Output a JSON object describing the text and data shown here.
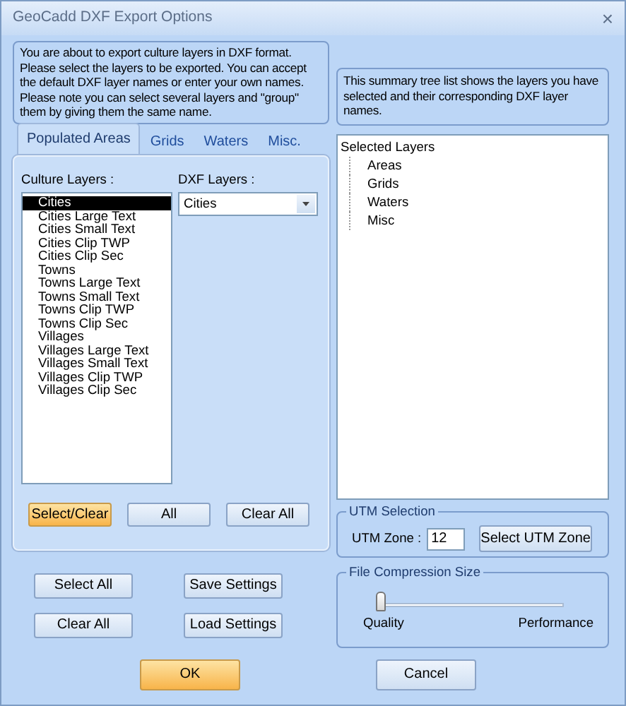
{
  "window": {
    "title": "GeoCadd DXF Export Options",
    "close": "×"
  },
  "intro": "You are about to export culture layers in DXF format. Please select the layers to be exported. You can accept the default DXF layer names or enter your own names. Please note you can select several layers and \"group\" them by giving them the same name.",
  "tabs": [
    {
      "label": "Populated Areas",
      "selected": true
    },
    {
      "label": "Grids",
      "selected": false
    },
    {
      "label": "Waters",
      "selected": false
    },
    {
      "label": "Misc.",
      "selected": false
    }
  ],
  "culture_label": "Culture Layers :",
  "culture_layers": [
    {
      "label": "Cities",
      "selected": true
    },
    {
      "label": "Cities Large Text",
      "selected": false
    },
    {
      "label": "Cities Small Text",
      "selected": false
    },
    {
      "label": "Cities Clip TWP",
      "selected": false
    },
    {
      "label": "Cities Clip Sec",
      "selected": false
    },
    {
      "label": "Towns",
      "selected": false
    },
    {
      "label": "Towns Large Text",
      "selected": false
    },
    {
      "label": "Towns Small Text",
      "selected": false
    },
    {
      "label": "Towns Clip TWP",
      "selected": false
    },
    {
      "label": "Towns Clip Sec",
      "selected": false
    },
    {
      "label": "Villages",
      "selected": false
    },
    {
      "label": "Villages Large Text",
      "selected": false
    },
    {
      "label": "Villages Small Text",
      "selected": false
    },
    {
      "label": "Villages Clip TWP",
      "selected": false
    },
    {
      "label": "Villages Clip Sec",
      "selected": false
    }
  ],
  "dxf_label": "DXF Layers :",
  "dxf_value": "Cities",
  "tab_buttons": [
    {
      "label": "Select/Clear",
      "highlighted": true
    },
    {
      "label": "All",
      "highlighted": false
    },
    {
      "label": "Clear All",
      "highlighted": false
    }
  ],
  "left_buttons": [
    {
      "label": "Select All"
    },
    {
      "label": "Save Settings"
    },
    {
      "label": "Clear All"
    },
    {
      "label": "Load Settings"
    }
  ],
  "summary": "This summary tree list shows the layers you have selected and their corresponding DXF layer names.",
  "tree": {
    "label": "Selected Layers",
    "children": [
      {
        "label": "Areas"
      },
      {
        "label": "Grids"
      },
      {
        "label": "Waters"
      },
      {
        "label": "Misc"
      }
    ]
  },
  "utm": {
    "title": "UTM Selection",
    "label": "UTM Zone :",
    "value": "12",
    "button": "Select UTM Zone"
  },
  "compression": {
    "title": "File Compression Size",
    "level": 0,
    "min_label": "Quality",
    "max_label": "Performance"
  },
  "dialog_buttons": [
    {
      "label": "OK",
      "highlighted": true
    },
    {
      "label": "Cancel",
      "highlighted": false
    }
  ]
}
